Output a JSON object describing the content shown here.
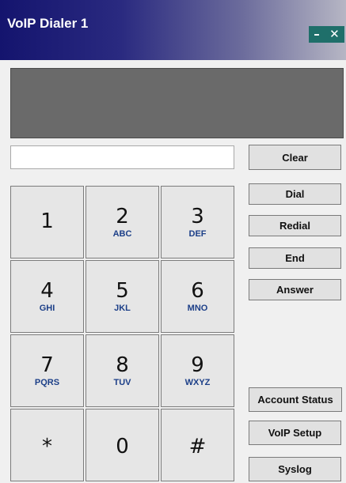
{
  "window": {
    "title": "VoIP Dialer 1",
    "minimize_glyph": "–",
    "close_glyph": "✕"
  },
  "number_field": {
    "value": "",
    "placeholder": ""
  },
  "keypad": [
    {
      "digit": "1",
      "letters": ""
    },
    {
      "digit": "2",
      "letters": "ABC"
    },
    {
      "digit": "3",
      "letters": "DEF"
    },
    {
      "digit": "4",
      "letters": "GHI"
    },
    {
      "digit": "5",
      "letters": "JKL"
    },
    {
      "digit": "6",
      "letters": "MNO"
    },
    {
      "digit": "7",
      "letters": "PQRS"
    },
    {
      "digit": "8",
      "letters": "TUV"
    },
    {
      "digit": "9",
      "letters": "WXYZ"
    },
    {
      "digit": "*",
      "letters": ""
    },
    {
      "digit": "0",
      "letters": ""
    },
    {
      "digit": "#",
      "letters": ""
    }
  ],
  "buttons": {
    "clear": "Clear",
    "dial": "Dial",
    "redial": "Redial",
    "end": "End",
    "answer": "Answer",
    "account_status": "Account Status",
    "voip_setup": "VoIP Setup",
    "syslog": "Syslog"
  },
  "colors": {
    "title_gradient_start": "#14146e",
    "title_gradient_end": "#b6b6c4",
    "window_buttons_bg": "#1f6f6a",
    "display_bg": "#6a6a6a",
    "keypad_letters": "#1c3f88"
  },
  "icons": {
    "minimize": "minimize-icon",
    "close": "close-icon"
  }
}
